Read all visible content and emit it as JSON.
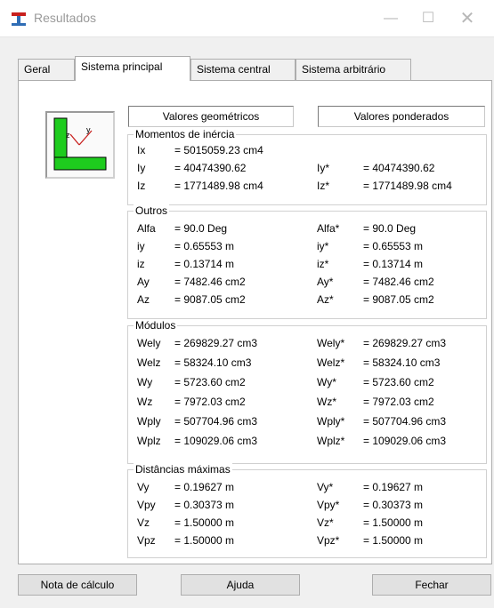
{
  "window": {
    "title": "Resultados"
  },
  "tabs": [
    {
      "label": "Geral"
    },
    {
      "label": "Sistema principal"
    },
    {
      "label": "Sistema central"
    },
    {
      "label": "Sistema arbitrário"
    }
  ],
  "headers": {
    "geometric": "Valores geométricos",
    "weighted": "Valores ponderados"
  },
  "section_icon": {
    "label": "z"
  },
  "inercia": {
    "title": "Momentos de inércia",
    "rows": [
      {
        "n1": "Ix",
        "v1": "= 5015059.23 cm4",
        "n2": "",
        "v2": ""
      },
      {
        "n1": "Iy",
        "v1": "= 40474390.62",
        "n2": "Iy*",
        "v2": "= 40474390.62"
      },
      {
        "n1": "Iz",
        "v1": "= 1771489.98 cm4",
        "n2": "Iz*",
        "v2": "= 1771489.98 cm4"
      }
    ]
  },
  "outros": {
    "title": "Outros",
    "rows": [
      {
        "n1": "Alfa",
        "v1": "= 90.0 Deg",
        "n2": "Alfa*",
        "v2": "= 90.0 Deg"
      },
      {
        "n1": "iy",
        "v1": "= 0.65553 m",
        "n2": "iy*",
        "v2": "= 0.65553 m"
      },
      {
        "n1": "iz",
        "v1": "= 0.13714 m",
        "n2": "iz*",
        "v2": "= 0.13714 m"
      },
      {
        "n1": "Ay",
        "v1": "= 7482.46 cm2",
        "n2": "Ay*",
        "v2": "= 7482.46 cm2"
      },
      {
        "n1": "Az",
        "v1": "= 9087.05 cm2",
        "n2": "Az*",
        "v2": "= 9087.05 cm2"
      }
    ]
  },
  "modulos": {
    "title": "Módulos",
    "rows": [
      {
        "n1": "Wely",
        "v1": "= 269829.27 cm3",
        "n2": "Wely*",
        "v2": "= 269829.27 cm3"
      },
      {
        "n1": "Welz",
        "v1": "= 58324.10 cm3",
        "n2": "Welz*",
        "v2": "= 58324.10 cm3"
      },
      {
        "n1": "Wy",
        "v1": "= 5723.60 cm2",
        "n2": "Wy*",
        "v2": "= 5723.60 cm2"
      },
      {
        "n1": "Wz",
        "v1": "= 7972.03 cm2",
        "n2": "Wz*",
        "v2": "= 7972.03 cm2"
      },
      {
        "n1": "Wply",
        "v1": "= 507704.96 cm3",
        "n2": "Wply*",
        "v2": "= 507704.96 cm3"
      },
      {
        "n1": "Wplz",
        "v1": "= 109029.06 cm3",
        "n2": "Wplz*",
        "v2": "= 109029.06 cm3"
      }
    ]
  },
  "distancias": {
    "title": "Distâncias máximas",
    "rows": [
      {
        "n1": "Vy",
        "v1": "= 0.19627 m",
        "n2": "Vy*",
        "v2": "= 0.19627 m"
      },
      {
        "n1": "Vpy",
        "v1": "= 0.30373 m",
        "n2": "Vpy*",
        "v2": "= 0.30373 m"
      },
      {
        "n1": "Vz",
        "v1": "= 1.50000 m",
        "n2": "Vz*",
        "v2": "= 1.50000 m"
      },
      {
        "n1": "Vpz",
        "v1": "= 1.50000 m",
        "n2": "Vpz*",
        "v2": "= 1.50000 m"
      }
    ]
  },
  "buttons": {
    "nota": "Nota de cálculo",
    "ajuda": "Ajuda",
    "fechar": "Fechar"
  },
  "colors": {
    "section_fill": "#1ecc1e",
    "accent": "#0078d7"
  }
}
